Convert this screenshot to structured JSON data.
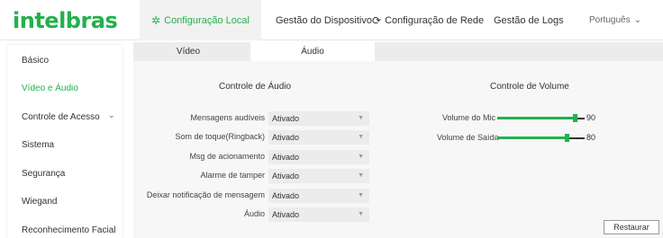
{
  "brand": {
    "logo": "intelbras"
  },
  "nav": {
    "local": "Configuração Local",
    "dispositivo": "Gestão do Dispositivo",
    "rede": "Configuração de Rede",
    "logs": "Gestão de Logs",
    "language": "Português"
  },
  "sidebar": {
    "items": [
      {
        "label": "Básico"
      },
      {
        "label": "Vídeo e Áudio"
      },
      {
        "label": "Controle de Acesso"
      },
      {
        "label": "Sistema"
      },
      {
        "label": "Segurança"
      },
      {
        "label": "Wiegand"
      },
      {
        "label": "Reconhecimento Facial"
      }
    ]
  },
  "tabs": {
    "video": "Vídeo",
    "audio": "Áudio"
  },
  "audio_control": {
    "title": "Controle de Áudio",
    "rows": [
      {
        "label": "Mensagens audíveis",
        "value": "Ativado"
      },
      {
        "label": "Som de toque(Ringback)",
        "value": "Ativado"
      },
      {
        "label": "Msg de acionamento",
        "value": "Ativado"
      },
      {
        "label": "Alarme de tamper",
        "value": "Ativado"
      },
      {
        "label": "Deixar notificação de mensagem",
        "value": "Ativado"
      },
      {
        "label": "Áudio",
        "value": "Ativado"
      }
    ]
  },
  "volume_control": {
    "title": "Controle de Volume",
    "mic": {
      "label": "Volume do Mic",
      "value": "90"
    },
    "saida": {
      "label": "Volume de Saída",
      "value": "80"
    }
  },
  "buttons": {
    "restore": "Restaurar"
  }
}
